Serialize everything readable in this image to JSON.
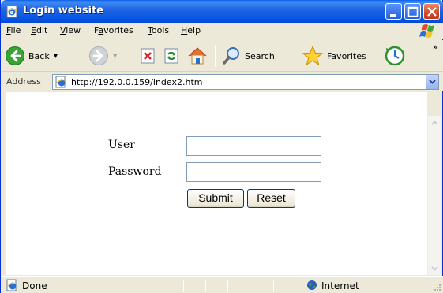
{
  "window": {
    "title": "Login website"
  },
  "menu": {
    "items": [
      {
        "label": "File",
        "accel": "F"
      },
      {
        "label": "Edit",
        "accel": "E"
      },
      {
        "label": "View",
        "accel": "V"
      },
      {
        "label": "Favorites",
        "accel": "a"
      },
      {
        "label": "Tools",
        "accel": "T"
      },
      {
        "label": "Help",
        "accel": "H"
      }
    ]
  },
  "toolbar": {
    "back_label": "Back",
    "search_label": "Search",
    "favorites_label": "Favorites",
    "more_glyph": "»"
  },
  "address": {
    "label": "Address",
    "url": "http://192.0.0.159/index2.htm"
  },
  "form": {
    "user_label": "User",
    "password_label": "Password",
    "user_value": "",
    "password_value": "",
    "submit_label": "Submit",
    "reset_label": "Reset"
  },
  "status": {
    "text": "Done",
    "zone": "Internet"
  },
  "colors": {
    "titlebar": "#0054e3",
    "chrome": "#ece9d8",
    "close_button": "#d34a26"
  }
}
